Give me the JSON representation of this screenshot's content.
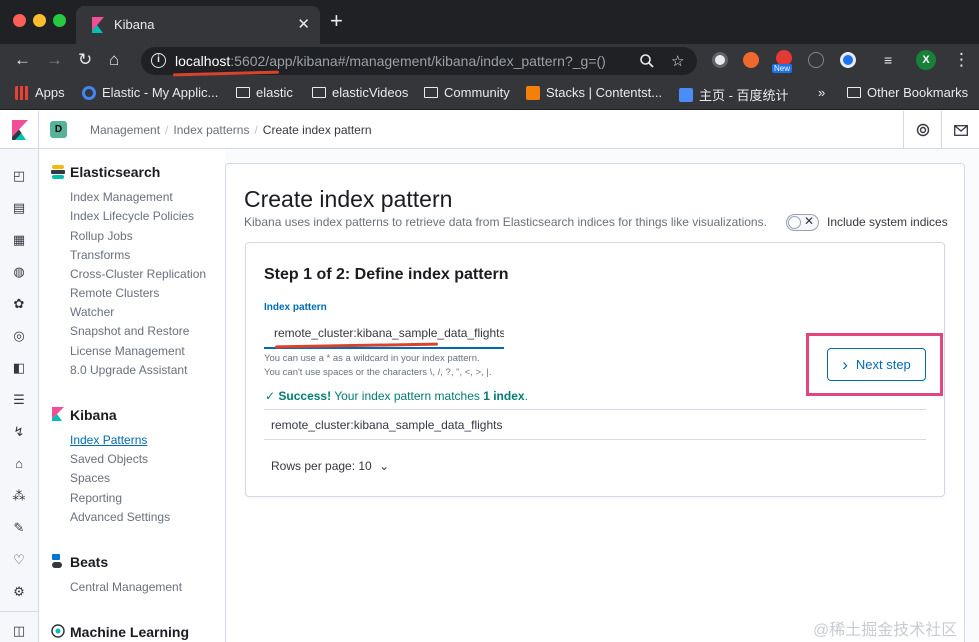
{
  "browser": {
    "tab_title": "Kibana",
    "tab_close": "✕",
    "new_tab": "+",
    "url_host": "localhost",
    "url_rest": ":5602/app/kibana#/management/kibana/index_pattern?_g=()",
    "ext_initial": "X",
    "new_badge": "New",
    "bookmarks": [
      {
        "label": "Apps"
      },
      {
        "label": "Elastic - My Applic..."
      },
      {
        "label": "elastic"
      },
      {
        "label": "elasticVideos"
      },
      {
        "label": "Community"
      },
      {
        "label": "Stacks | Contentst..."
      },
      {
        "label": "主页 - 百度统计"
      },
      {
        "label": "»"
      },
      {
        "label": "Other Bookmarks"
      }
    ]
  },
  "header": {
    "space_initial": "D",
    "breadcrumbs": [
      "Management",
      "Index patterns",
      "Create index pattern"
    ]
  },
  "sidebar": {
    "elasticsearch": {
      "title": "Elasticsearch",
      "items": [
        "Index Management",
        "Index Lifecycle Policies",
        "Rollup Jobs",
        "Transforms",
        "Cross-Cluster Replication",
        "Remote Clusters",
        "Watcher",
        "Snapshot and Restore",
        "License Management",
        "8.0 Upgrade Assistant"
      ]
    },
    "kibana": {
      "title": "Kibana",
      "items": [
        "Index Patterns",
        "Saved Objects",
        "Spaces",
        "Reporting",
        "Advanced Settings"
      ]
    },
    "beats": {
      "title": "Beats",
      "items": [
        "Central Management"
      ]
    },
    "ml": {
      "title": "Machine Learning"
    }
  },
  "main": {
    "title": "Create index pattern",
    "description": "Kibana uses index patterns to retrieve data from Elasticsearch indices for things like visualizations.",
    "include_system_label": "Include system indices",
    "toggle_x": "✕",
    "step_title": "Step 1 of 2: Define index pattern",
    "field_label": "Index pattern",
    "field_value": "remote_cluster:kibana_sample_data_flights",
    "help_line1": "You can use a * as a wildcard in your index pattern.",
    "help_line2": "You can't use spaces or the characters \\, /, ?, \", <, >, |.",
    "success_check": "✓",
    "success_bold": "Success!",
    "success_text": " Your index pattern matches ",
    "success_count": "1 index",
    "success_end": ".",
    "match_result": "remote_cluster:kibana_sample_data_flights",
    "rows_per_page": "Rows per page: 10",
    "rows_chevron": "⌄",
    "next_chevron": "›",
    "next_label": "Next step"
  },
  "watermark": "@稀土掘金技术社区",
  "colors": {
    "accent": "#006bb4",
    "success": "#017d73",
    "highlight": "#e2467e",
    "annotation": "#d8432e"
  }
}
